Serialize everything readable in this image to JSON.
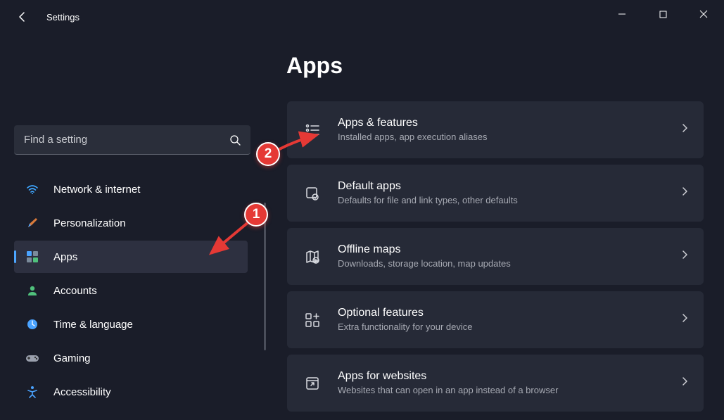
{
  "window": {
    "title": "Settings"
  },
  "search": {
    "placeholder": "Find a setting"
  },
  "page": {
    "title": "Apps"
  },
  "sidebar": {
    "items": [
      {
        "label": "Network & internet"
      },
      {
        "label": "Personalization"
      },
      {
        "label": "Apps"
      },
      {
        "label": "Accounts"
      },
      {
        "label": "Time & language"
      },
      {
        "label": "Gaming"
      },
      {
        "label": "Accessibility"
      }
    ]
  },
  "cards": [
    {
      "title": "Apps & features",
      "subtitle": "Installed apps, app execution aliases"
    },
    {
      "title": "Default apps",
      "subtitle": "Defaults for file and link types, other defaults"
    },
    {
      "title": "Offline maps",
      "subtitle": "Downloads, storage location, map updates"
    },
    {
      "title": "Optional features",
      "subtitle": "Extra functionality for your device"
    },
    {
      "title": "Apps for websites",
      "subtitle": "Websites that can open in an app instead of a browser"
    }
  ],
  "annotations": {
    "badge1": "1",
    "badge2": "2"
  }
}
